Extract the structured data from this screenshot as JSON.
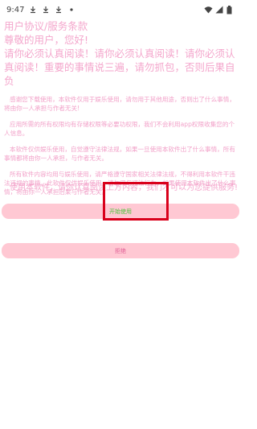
{
  "status_bar": {
    "time": "9:47",
    "left_icons": [
      "download-icon",
      "download-icon",
      "download-icon",
      "dot-icon"
    ],
    "right_icons": [
      "wifi-icon",
      "signal-icon",
      "battery-icon"
    ]
  },
  "title": {
    "line1": "用户协议/服务条款",
    "line2": "尊敬的用户，您好!",
    "line3": "请你必须认真阅读！请你必须认真阅读！请你必须认真阅读！重要的事情说三遍，请勿抓包，否则后果自负"
  },
  "paragraphs": [
    "感谢您下载使用，本软件仅用于娱乐使用，请勿用于其他用途，否则出了什么事情，将由你一人承担与作者无关!",
    "应用所需的所有权限均有存储权限等必要功权限，我们不会利用app权限收集您的个人信息。",
    "本软件仅供娱乐使用，自觉遵守法律法规，如果一旦使用本软件出了什么事情，所有事情都将由你一人承担，与作者无关。",
    "所有软件内容均用与娱乐使用，请严格遵守国家相关法律法规，不得利用本软件干违法违规的事情，此软件仅供娱乐使用，请勿用与违法行为，如果使用本软件出了什么事情，将由你一人承担后果与作者无关。"
  ],
  "bottom_text": "使用本软件，请你认真阅读上方内容，我们才可以为您提供服务!",
  "buttons": {
    "agree": "开始使用",
    "refuse": "拒绝"
  },
  "colors": {
    "text_pink": "#f4a6cc",
    "button_bg": "#ffc8d3",
    "agree_text": "#4cc43c",
    "refuse_text": "#e06096",
    "highlight": "#d9001b"
  }
}
